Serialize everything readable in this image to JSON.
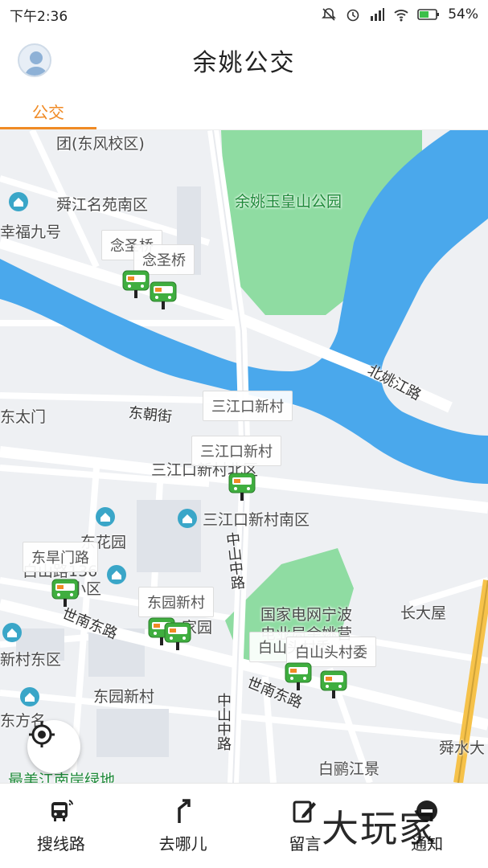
{
  "status_bar": {
    "time": "下午2:36",
    "battery": "54%"
  },
  "header": {
    "title": "余姚公交"
  },
  "tabs": [
    {
      "label": "公交",
      "active": true
    }
  ],
  "map": {
    "labels": {
      "dongfeng": "团(东风校区)",
      "shunjiang_south": "舜江名苑南区",
      "fu9": "幸福九号",
      "park": "余姚玉皇山公园",
      "north_yaojiang": "北姚江路",
      "dongtaimen": "东太门",
      "dongchao": "东朝街",
      "sanjiang_north": "三江口新村北区",
      "sanjiang_south": "三江口新村南区",
      "donghuayuan": "东花园",
      "baishanlu": "白山路136",
      "xiaoqu": "小区",
      "zhongshan_mid": "中山中路",
      "grid_company": "国家电网宁波",
      "grid_company2": "电业局余姚营",
      "changdawu": "长大屋",
      "shinan_east_left": "世南东路",
      "shinan_east_right": "世南东路",
      "jiayuan": "家园",
      "xincun_east": "新村东区",
      "dongyuan_xincun": "东园新村",
      "dongfang": "东方名",
      "zhongshan_mid2": "中山中路",
      "bailu": "白鹂江景",
      "shunshui": "舜水大",
      "zuimei": "最美江南岸绿地"
    },
    "stops": {
      "nianshengqiao": "念圣桥",
      "sanjiangkou_a": "三江口新村",
      "sanjiangkou_b": "三江口新村",
      "donghaomenlu": "东旱门路",
      "dongyuan_xincun": "东园新村",
      "baishantou": "白山头村委"
    }
  },
  "bottom_nav": [
    {
      "label": "搜线路",
      "icon": "bus-search-icon"
    },
    {
      "label": "去哪儿",
      "icon": "route-turn-icon"
    },
    {
      "label": "留言",
      "icon": "edit-message-icon"
    },
    {
      "label": "通知",
      "icon": "notification-icon"
    }
  ],
  "watermark": "大玩家",
  "colors": {
    "accent": "#f08a24",
    "river": "#4aa8ec",
    "park": "#8fdca2",
    "bus_marker": "#3fae3f"
  }
}
